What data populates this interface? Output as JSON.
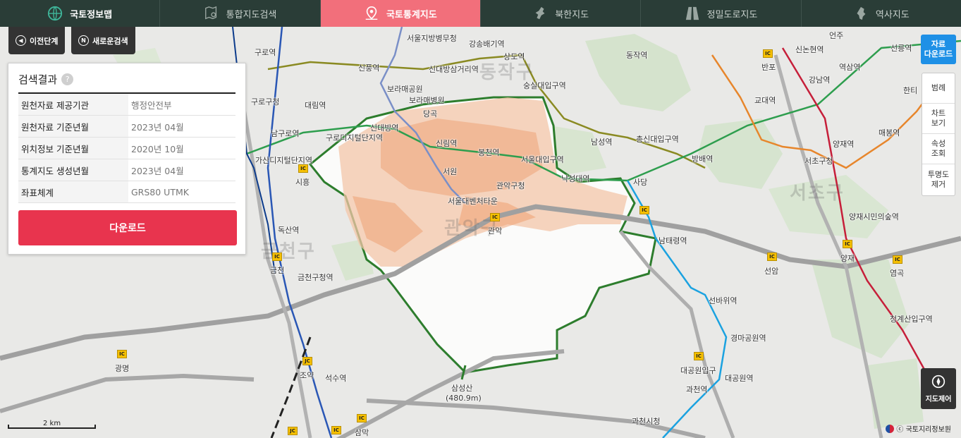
{
  "nav": {
    "tabs": [
      {
        "label": "국토정보맵",
        "icon": "globe-icon"
      },
      {
        "label": "통합지도검색",
        "icon": "map-search-icon"
      },
      {
        "label": "국토통계지도",
        "icon": "map-pin-icon"
      },
      {
        "label": "북한지도",
        "icon": "north-korea-icon"
      },
      {
        "label": "정밀도로지도",
        "icon": "road-icon"
      },
      {
        "label": "역사지도",
        "icon": "history-map-icon"
      }
    ],
    "active_tab": "국토통계지도"
  },
  "buttons": {
    "prev": "이전단계",
    "new_search": "새로운검색"
  },
  "result_panel": {
    "title": "검색결과",
    "help": "?",
    "rows": [
      {
        "key": "원천자료 제공기관",
        "value": "행정안전부"
      },
      {
        "key": "원천자료 기준년월",
        "value": "2023년 04월"
      },
      {
        "key": "위치정보 기준년월",
        "value": "2020년 10월"
      },
      {
        "key": "통계지도 생성년월",
        "value": "2023년 04월"
      },
      {
        "key": "좌표체계",
        "value": "GRS80 UTMK"
      }
    ],
    "download": "다운로드"
  },
  "right_tools": {
    "data_download": [
      "자료",
      "다운로드"
    ],
    "items": [
      [
        "범례"
      ],
      [
        "차트",
        "보기"
      ],
      [
        "속성",
        "조회"
      ],
      [
        "투명도",
        "제거"
      ]
    ],
    "map_control": "지도제어"
  },
  "scale_label": "2 km",
  "copyright": "ⓒ 국토지리정보원",
  "map": {
    "districts": [
      "동작구",
      "금천구",
      "관악구",
      "서초구"
    ],
    "labels": [
      "서울지방병무청",
      "강송배기역",
      "상도역",
      "신풍역",
      "신대방삼거리역",
      "보라매공원",
      "숭실대입구역",
      "보라매병원",
      "구로역",
      "대림역",
      "구로구청",
      "남구로역",
      "구로디지털단지역",
      "신대방역",
      "당곡",
      "신림역",
      "봉천역",
      "서울대입구역",
      "서원",
      "낙성대역",
      "관악구청",
      "가산디지털단지역",
      "시흥",
      "서울대벤처타운",
      "관악",
      "독산역",
      "금천",
      "금천구청역",
      "삼성산",
      "(480.9m)",
      "석수역",
      "삼막",
      "광명",
      "조약",
      "남성역",
      "총신대입구역",
      "방배역",
      "동작역",
      "사당",
      "남태령역",
      "선바위역",
      "경마공원역",
      "대공원입구",
      "대공원역",
      "과천역",
      "과천시청",
      "선암",
      "양재",
      "염곡",
      "청계산입구역",
      "양재역",
      "서초구청",
      "양재시민의숲역",
      "매봉역",
      "교대역",
      "강남역",
      "역삼역",
      "신논현역",
      "반포",
      "언주",
      "선릉역",
      "한티"
    ]
  }
}
